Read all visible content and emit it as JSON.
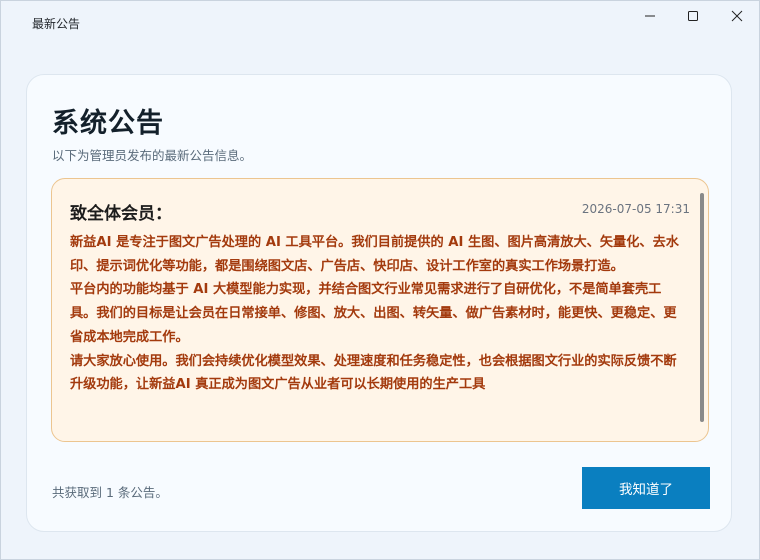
{
  "window": {
    "title": "最新公告",
    "minimize_icon": "minimize-icon",
    "maximize_icon": "maximize-icon",
    "close_icon": "close-icon"
  },
  "header": {
    "title": "系统公告",
    "subtitle": "以下为管理员发布的最新公告信息。"
  },
  "notice": {
    "heading": "致全体会员：",
    "timestamp": "2026-07-05 17:31",
    "paragraphs": [
      "新益AI 是专注于图文广告处理的 AI 工具平台。我们目前提供的 AI 生图、图片高清放大、矢量化、去水印、提示词优化等功能，都是围绕图文店、广告店、快印店、设计工作室的真实工作场景打造。",
      "平台内的功能均基于 AI 大模型能力实现，并结合图文行业常见需求进行了自研优化，不是简单套壳工具。我们的目标是让会员在日常接单、修图、放大、出图、转矢量、做广告素材时，能更快、更稳定、更省成本地完成工作。",
      "请大家放心使用。我们会持续优化模型效果、处理速度和任务稳定性，也会根据图文行业的实际反馈不断升级功能，让新益AI 真正成为图文广告从业者可以长期使用的生产工具"
    ],
    "text_color": "#a33a0d"
  },
  "footer": {
    "count_text": "共获取到 1 条公告。",
    "ok_label": "我知道了",
    "accent": "#0a7fc0"
  }
}
